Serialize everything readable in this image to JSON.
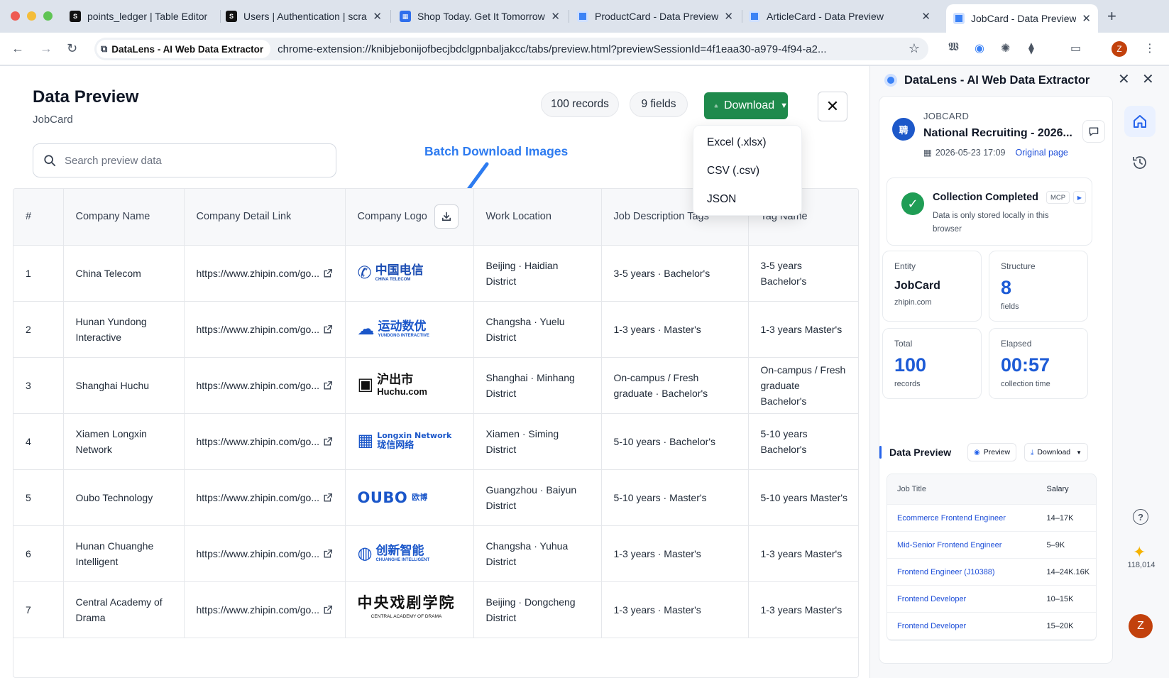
{
  "browser": {
    "tabs": [
      {
        "title": "points_ledger | Table Editor",
        "icon": "supabase-icon"
      },
      {
        "title": "Users | Authentication | scrap",
        "icon": "supabase-icon"
      },
      {
        "title": "Shop Today. Get It Tomorrow",
        "icon": "store-icon"
      },
      {
        "title": "ProductCard - Data Preview",
        "icon": "datalens-icon"
      },
      {
        "title": "ArticleCard - Data Preview",
        "icon": "datalens-icon"
      },
      {
        "title": "JobCard - Data Preview",
        "icon": "datalens-icon",
        "active": true
      }
    ],
    "site_chip": "DataLens - AI Web Data Extractor",
    "url": "chrome-extension://knibjebonijofbecjbdclgpnbaljakcc/tabs/preview.html?previewSessionId=4f1eaa30-a979-4f94-a2...",
    "profile_initial": "Z"
  },
  "main": {
    "title": "Data Preview",
    "subtitle": "JobCard",
    "records_pill": "100 records",
    "fields_pill": "9 fields",
    "download_label": "Download",
    "download_menu": [
      "Excel (.xlsx)",
      "CSV (.csv)",
      "JSON"
    ],
    "search_placeholder": "Search preview data",
    "annotation": "Batch Download Images",
    "columns": [
      "#",
      "Company Name",
      "Company Detail Link",
      "Company Logo",
      "Work Location",
      "Job Description Tags",
      "Tag Name"
    ],
    "rows": [
      {
        "n": "1",
        "company": "China Telecom",
        "link": "https://www.zhipin.com/go...",
        "logo": {
          "mark": "✆",
          "text": "中国电信",
          "sub": "CHINA TELECOM",
          "color": "#1b4db3"
        },
        "location": "Beijing · Haidian District",
        "tags": "3-5 years · Bachelor's",
        "tag_name": "3-5 years Bachelor's"
      },
      {
        "n": "2",
        "company": "Hunan Yundong Interactive",
        "link": "https://www.zhipin.com/go...",
        "logo": {
          "mark": "☁",
          "text": "运动数优",
          "sub": "YUNDONG INTERACTIVE",
          "color": "#1a56c9"
        },
        "location": "Changsha · Yuelu District",
        "tags": "1-3 years · Master's",
        "tag_name": "1-3 years Master's"
      },
      {
        "n": "3",
        "company": "Shanghai Huchu",
        "link": "https://www.zhipin.com/go...",
        "logo": {
          "mark": "▣",
          "text": "沪出市",
          "sub": "Huchu.com",
          "color": "#111111"
        },
        "location": "Shanghai · Minhang District",
        "tags": "On-campus / Fresh graduate · Bachelor's",
        "tag_name": "On-campus / Fresh graduate Bachelor's"
      },
      {
        "n": "4",
        "company": "Xiamen Longxin Network",
        "link": "https://www.zhipin.com/go...",
        "logo": {
          "mark": "▦",
          "text": "Longxin Network",
          "sub": "珑信网络",
          "color": "#1a56c9"
        },
        "location": "Xiamen · Siming District",
        "tags": "5-10 years · Bachelor's",
        "tag_name": "5-10 years Bachelor's"
      },
      {
        "n": "5",
        "company": "Oubo Technology",
        "link": "https://www.zhipin.com/go...",
        "logo": {
          "mark": "",
          "text": "OUBO",
          "sub": "欧博",
          "color": "#1a56c9"
        },
        "location": "Guangzhou · Baiyun District",
        "tags": "5-10 years · Master's",
        "tag_name": "5-10 years Master's"
      },
      {
        "n": "6",
        "company": "Hunan Chuanghe Intelligent",
        "link": "https://www.zhipin.com/go...",
        "logo": {
          "mark": "◍",
          "text": "创新智能",
          "sub": "CHUANGHE INTELLIGENT",
          "color": "#1a56c9"
        },
        "location": "Changsha · Yuhua District",
        "tags": "1-3 years · Master's",
        "tag_name": "1-3 years Master's"
      },
      {
        "n": "7",
        "company": "Central Academy of Drama",
        "link": "https://www.zhipin.com/go...",
        "logo": {
          "mark": "",
          "text": "中央戏剧学院",
          "sub": "CENTRAL ACADEMY OF DRAMA",
          "color": "#111111"
        },
        "location": "Beijing · Dongcheng District",
        "tags": "1-3 years · Master's",
        "tag_name": "1-3 years Master's"
      }
    ]
  },
  "side": {
    "title": "DataLens - AI Web Data Extractor",
    "job": {
      "kind": "JOBCARD",
      "name": "National Recruiting - 2026...",
      "date": "2026-05-23 17:09",
      "original_link": "Original page",
      "avatar": "聘"
    },
    "status": {
      "title": "Collection Completed",
      "desc": "Data is only stored locally in this browser",
      "badge": "MCP"
    },
    "stats": {
      "entity_label": "Entity",
      "entity_value": "JobCard",
      "entity_sub": "zhipin.com",
      "structure_label": "Structure",
      "structure_value": "8",
      "structure_sub": "fields",
      "total_label": "Total",
      "total_value": "100",
      "total_sub": "records",
      "elapsed_label": "Elapsed",
      "elapsed_value": "00:57",
      "elapsed_sub": "collection time"
    },
    "preview": {
      "title": "Data Preview",
      "preview_btn": "Preview",
      "download_btn": "Download",
      "col1": "Job Title",
      "col2": "Salary",
      "rows": [
        {
          "title": "Ecommerce Frontend Engineer",
          "salary": "14–17K"
        },
        {
          "title": "Mid-Senior Frontend Engineer",
          "salary": "5–9K"
        },
        {
          "title": "Frontend Engineer (J10388)",
          "salary": "14–24K.16K"
        },
        {
          "title": "Frontend Developer",
          "salary": "10–15K"
        },
        {
          "title": "Frontend Developer",
          "salary": "15–20K"
        }
      ]
    },
    "rail": {
      "credits": "118,014",
      "avatar": "Z"
    }
  },
  "colors": {
    "accent_green": "#1f8a4c",
    "accent_blue": "#2563eb",
    "annotation_blue": "#2d7bf0"
  }
}
